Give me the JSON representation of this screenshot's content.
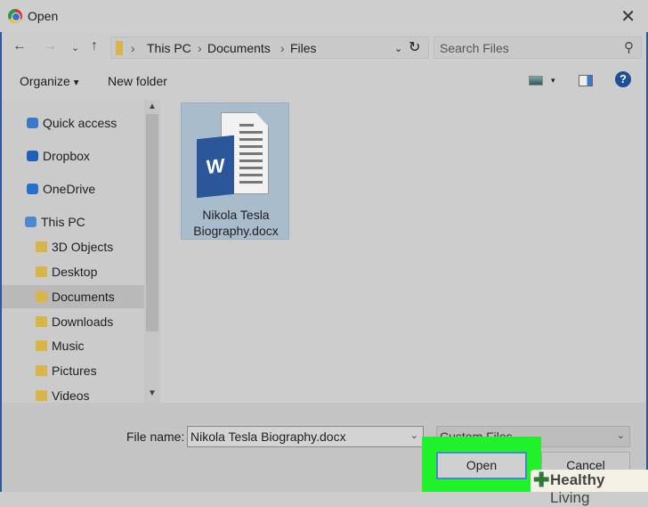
{
  "window": {
    "title": "Open"
  },
  "address": {
    "segments": [
      "This PC",
      "Documents",
      "Files"
    ]
  },
  "search": {
    "placeholder": "Search Files"
  },
  "toolbar": {
    "organize": "Organize",
    "new_folder": "New folder"
  },
  "sidebar": {
    "items": [
      {
        "label": "Quick access",
        "icon": "star-icon",
        "color": "#3a78c8"
      },
      {
        "label": "Dropbox",
        "icon": "dropbox-icon",
        "color": "#1f5fb8"
      },
      {
        "label": "OneDrive",
        "icon": "cloud-icon",
        "color": "#2a6fd0"
      },
      {
        "label": "This PC",
        "icon": "computer-icon",
        "color": "#4a8ad0"
      },
      {
        "label": "3D Objects",
        "icon": "folder-icon",
        "color": "#d8b548"
      },
      {
        "label": "Desktop",
        "icon": "folder-icon",
        "color": "#d8b548"
      },
      {
        "label": "Documents",
        "icon": "folder-icon",
        "color": "#d8b548",
        "selected": true
      },
      {
        "label": "Downloads",
        "icon": "folder-icon",
        "color": "#d8b548"
      },
      {
        "label": "Music",
        "icon": "folder-icon",
        "color": "#d8b548"
      },
      {
        "label": "Pictures",
        "icon": "folder-icon",
        "color": "#d8b548"
      },
      {
        "label": "Videos",
        "icon": "folder-icon",
        "color": "#d8b548"
      }
    ]
  },
  "files": [
    {
      "name_line1": "Nikola Tesla",
      "name_line2": "Biography.docx",
      "badge": "W"
    }
  ],
  "footer": {
    "file_name_label": "File name:",
    "file_name_value": "Nikola Tesla Biography.docx",
    "file_type": "Custom Files",
    "open": "Open",
    "cancel": "Cancel"
  },
  "watermark": {
    "brand": "Healthy",
    "brand2": "Living"
  }
}
